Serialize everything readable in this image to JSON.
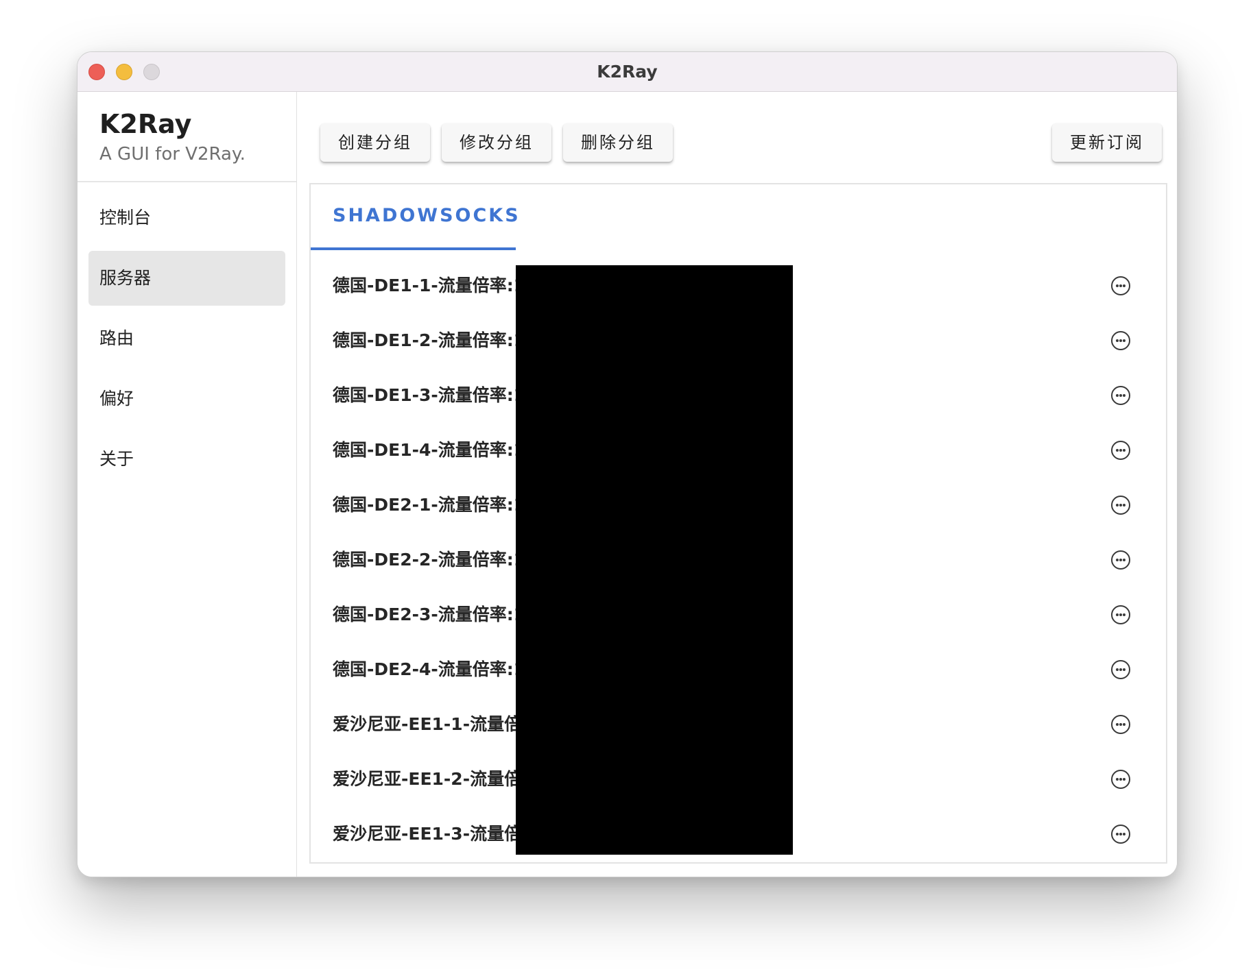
{
  "window": {
    "title": "K2Ray"
  },
  "sidebar": {
    "brand_title": "K2Ray",
    "brand_subtitle": "A GUI for V2Ray.",
    "items": [
      {
        "label": "控制台"
      },
      {
        "label": "服务器",
        "active": true
      },
      {
        "label": "路由"
      },
      {
        "label": "偏好"
      },
      {
        "label": "关于"
      }
    ]
  },
  "toolbar": {
    "create_group": "创建分组",
    "edit_group": "修改分组",
    "delete_group": "删除分组",
    "update_subscription": "更新订阅"
  },
  "tabs": [
    {
      "label": "SHADOWSOCKS",
      "active": true
    }
  ],
  "servers": [
    {
      "label": "德国-DE1-1-流量倍率:1.0 @"
    },
    {
      "label": "德国-DE1-2-流量倍率:1.0 @"
    },
    {
      "label": "德国-DE1-3-流量倍率:1.0 @"
    },
    {
      "label": "德国-DE1-4-流量倍率:1.0 @"
    },
    {
      "label": "德国-DE2-1-流量倍率:1.0 @"
    },
    {
      "label": "德国-DE2-2-流量倍率:1.0 @"
    },
    {
      "label": "德国-DE2-3-流量倍率:1.0 @"
    },
    {
      "label": "德国-DE2-4-流量倍率:1.0 @"
    },
    {
      "label": "爱沙尼亚-EE1-1-流量倍率:0"
    },
    {
      "label": "爱沙尼亚-EE1-2-流量倍率:0"
    },
    {
      "label": "爱沙尼亚-EE1-3-流量倍率:0"
    }
  ],
  "colors": {
    "accent": "#3f75d2",
    "sidebar_active_bg": "#e6e6e6",
    "titlebar_bg": "#f3eff4",
    "redaction": "#000000"
  },
  "icons": {
    "row_action": "more-horizontal-circle-icon"
  }
}
